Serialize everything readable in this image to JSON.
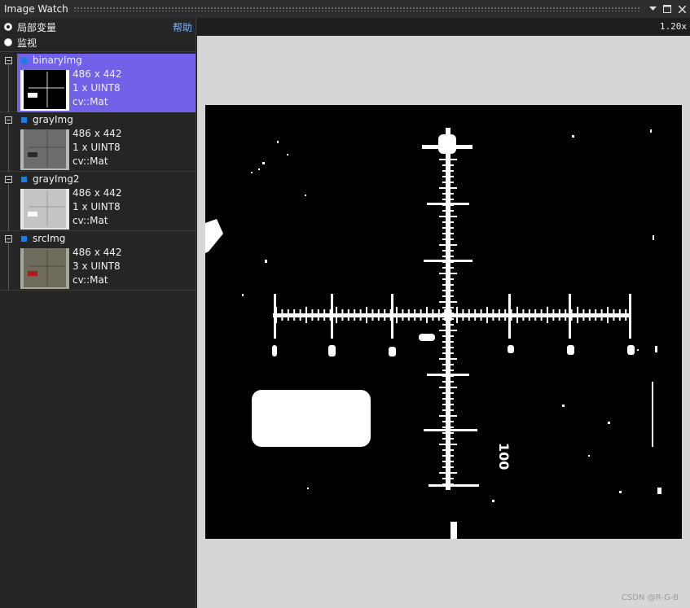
{
  "window": {
    "title": "Image Watch"
  },
  "toolbar": {
    "radio_locals": "局部变量",
    "radio_watch": "监视",
    "help": "帮助",
    "zoom": "1.20x"
  },
  "images": [
    {
      "name": "binaryImg",
      "size": "486 x 442",
      "channels": "1 x UINT8",
      "type": "cv::Mat",
      "selected": true
    },
    {
      "name": "grayImg",
      "size": "486 x 442",
      "channels": "1 x UINT8",
      "type": "cv::Mat",
      "selected": false
    },
    {
      "name": "grayImg2",
      "size": "486 x 442",
      "channels": "1 x UINT8",
      "type": "cv::Mat",
      "selected": false
    },
    {
      "name": "srcImg",
      "size": "486 x 442",
      "channels": "3 x UINT8",
      "type": "cv::Mat",
      "selected": false
    }
  ],
  "viewer": {
    "scale_label": "100",
    "watermark": "CSDN @R-G-B"
  },
  "colors": {
    "accent": "#7160e8",
    "bullet": "#1e7be0",
    "link": "#75b7ff"
  }
}
